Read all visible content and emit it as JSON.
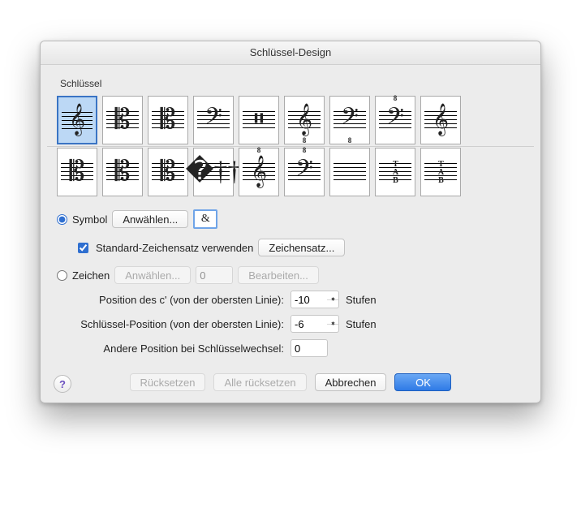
{
  "window": {
    "title": "Schlüssel-Design"
  },
  "clefs": {
    "label": "Schlüssel",
    "row1": [
      {
        "name": "treble-clef",
        "glyph": "𝄞",
        "selected": true
      },
      {
        "name": "alto-clef",
        "glyph": "𝄡"
      },
      {
        "name": "tenor-c-clef",
        "glyph": "𝄡"
      },
      {
        "name": "bass-clef",
        "glyph": "𝄢"
      },
      {
        "name": "percussion-clef",
        "glyph": "𝄥"
      },
      {
        "name": "treble-8vb",
        "glyph": "𝄞",
        "sub": "8"
      },
      {
        "name": "bass-8vb",
        "glyph": "𝄢",
        "sub": "8"
      },
      {
        "name": "bass-8va",
        "glyph": "𝄢",
        "sup": "8"
      },
      {
        "name": "treble-french",
        "glyph": "𝄞"
      }
    ],
    "row2": [
      {
        "name": "baritone-c-clef",
        "glyph": "𝄡"
      },
      {
        "name": "mezzo-c-clef",
        "glyph": "𝄡"
      },
      {
        "name": "soprano-c-clef",
        "glyph": "𝄡"
      },
      {
        "name": "percussion-2",
        "glyph": "�††"
      },
      {
        "name": "treble-8va",
        "glyph": "𝄞",
        "sup": "8"
      },
      {
        "name": "bass-8va-2",
        "glyph": "𝄢",
        "sup": "8"
      },
      {
        "name": "blank-clef",
        "glyph": ""
      },
      {
        "name": "tab-clef",
        "glyph": "TAB",
        "small": true
      },
      {
        "name": "tab-clef-serif",
        "glyph": "TAB",
        "small": true
      }
    ]
  },
  "symbol": {
    "radio_label": "Symbol",
    "select_button": "Anwählen...",
    "current": "&",
    "use_default_charset_label": "Standard-Zeichensatz verwenden",
    "use_default_charset_checked": true,
    "charset_button": "Zeichensatz..."
  },
  "zeichen": {
    "radio_label": "Zeichen",
    "select_button": "Anwählen...",
    "value": "0",
    "edit_button": "Bearbeiten..."
  },
  "positions": {
    "c_pos": {
      "label": "Position des c' (von der obersten Linie):",
      "value": "-10",
      "unit": "Stufen"
    },
    "clef_pos": {
      "label": "Schlüssel-Position (von der obersten Linie):",
      "value": "-6",
      "unit": "Stufen"
    },
    "other_pos": {
      "label": "Andere Position bei Schlüsselwechsel:",
      "value": "0"
    }
  },
  "buttons": {
    "reset": "Rücksetzen",
    "reset_all": "Alle rücksetzen",
    "cancel": "Abbrechen",
    "ok": "OK"
  },
  "help": "?"
}
